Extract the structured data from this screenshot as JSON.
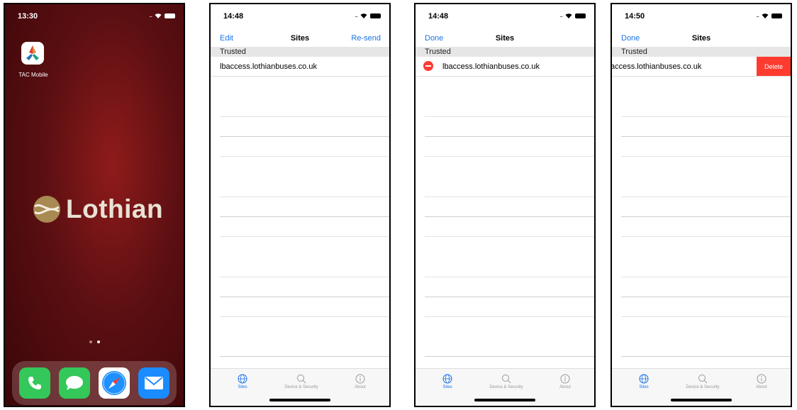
{
  "home": {
    "time": "13:30",
    "app_label": "TAC Mobile",
    "wallpaper_text": "Lothian",
    "dock": [
      "phone-icon",
      "messages-icon",
      "safari-icon",
      "mail-icon"
    ]
  },
  "screens": [
    {
      "time": "14:48",
      "nav_left": "Edit",
      "title": "Sites",
      "nav_right": "Re-send",
      "section": "Trusted",
      "row": "lbaccess.lothianbuses.co.uk",
      "tabs": [
        "Sites",
        "Device & Security",
        "About"
      ]
    },
    {
      "time": "14:48",
      "nav_left": "Done",
      "title": "Sites",
      "section": "Trusted",
      "row": "lbaccess.lothianbuses.co.uk",
      "tabs": [
        "Sites",
        "Device & Security",
        "About"
      ]
    },
    {
      "time": "14:50",
      "nav_left": "Done",
      "title": "Sites",
      "section": "Trusted",
      "row": "access.lothianbuses.co.uk",
      "delete_label": "Delete",
      "tabs": [
        "Sites",
        "Device & Security",
        "About"
      ]
    }
  ],
  "colors": {
    "accent": "#1a73e8",
    "destructive": "#ff3b30",
    "wallpaper": "#6a1216"
  }
}
